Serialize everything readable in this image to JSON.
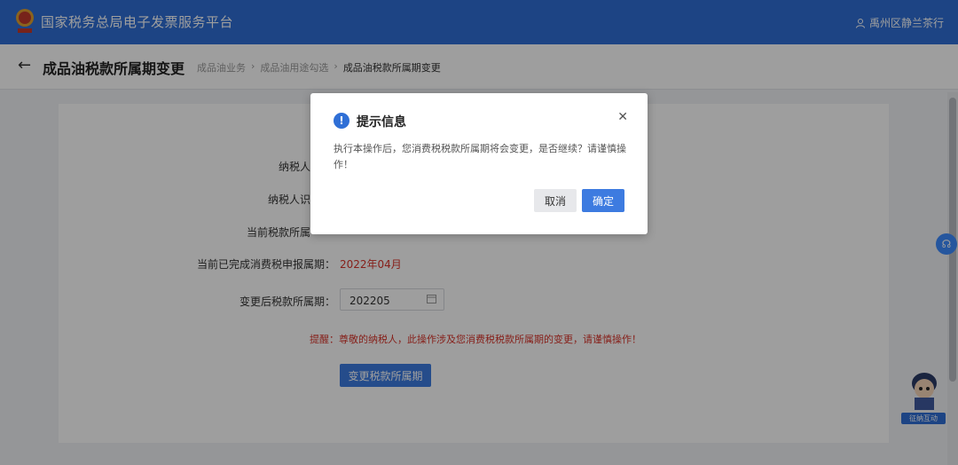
{
  "header": {
    "app_title": "国家税务总局电子发票服务平台",
    "user_name": "禹州区静兰茶行"
  },
  "subheader": {
    "page_title": "成品油税款所属期变更",
    "breadcrumb": [
      "成品油业务",
      "成品油用途勾选",
      "成品油税款所属期变更"
    ]
  },
  "form": {
    "rows": [
      {
        "label": "纳税人"
      },
      {
        "label": "纳税人识"
      },
      {
        "label": "当前税款所属"
      },
      {
        "label": "当前已完成消费税申报属期：",
        "value": "2022年04月"
      },
      {
        "label": "变更后税款所属期：",
        "input_value": "202205"
      }
    ],
    "warning": "提醒：尊敬的纳税人，此操作涉及您消费税税款所属期的变更，请谨慎操作！",
    "submit_label": "变更税款所属期"
  },
  "dialog": {
    "title": "提示信息",
    "body": "执行本操作后，您消费税税款所属期将会变更，是否继续？请谨慎操作！",
    "cancel_label": "取消",
    "confirm_label": "确定"
  },
  "assistant": {
    "label": "征纳互动"
  },
  "colors": {
    "brand": "#2f6fd6",
    "primary_button": "#3d7be0",
    "warning_text": "#d9342b"
  }
}
